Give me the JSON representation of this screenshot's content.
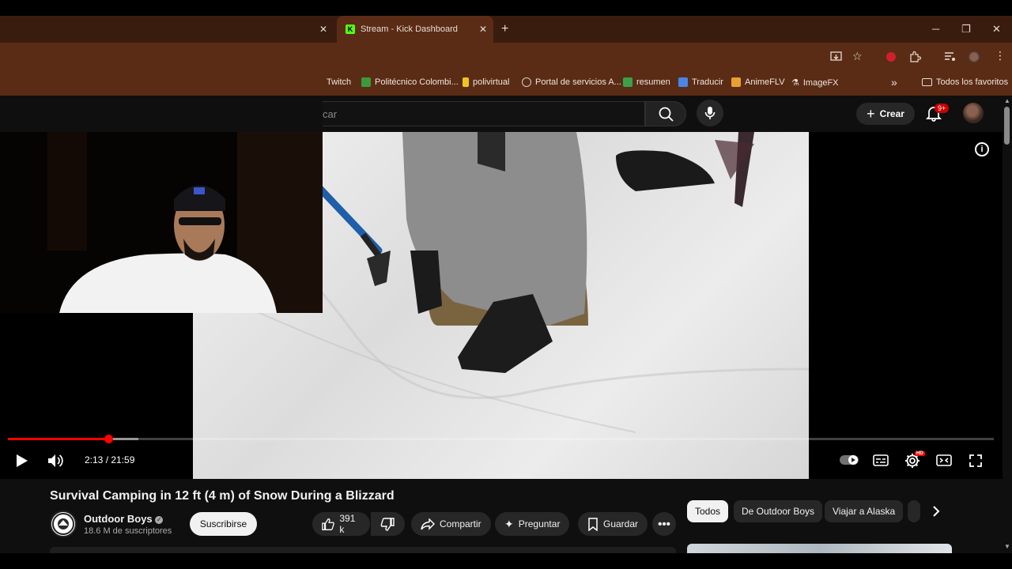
{
  "browser": {
    "tabs": [
      {
        "label": "Stream - Kick Dashboard",
        "icon": "kick-logo-icon"
      }
    ],
    "new_tab_symbol": "+",
    "bookmarks": [
      {
        "label": "Twitch"
      },
      {
        "label": "Politécnico Colombi..."
      },
      {
        "label": "polivirtual"
      },
      {
        "label": "Portal de servicios A..."
      },
      {
        "label": "resumen"
      },
      {
        "label": "Traducir"
      },
      {
        "label": "AnimeFLV"
      },
      {
        "label": "ImageFX"
      }
    ],
    "bookmarks_more": "»",
    "all_bookmarks": "Todos los favoritos"
  },
  "youtube": {
    "search_placeholder": "car",
    "create_label": "Crear",
    "notifications_badge": "9+"
  },
  "player": {
    "time_display": "2:13 / 21:59",
    "played_fraction": 0.102,
    "buffered_fraction": 0.132,
    "quality_badge": "HD",
    "info_symbol": "i"
  },
  "video": {
    "title": "Survival Camping in 12 ft (4 m) of Snow During a Blizzard",
    "channel_name": "Outdoor Boys",
    "channel_subs": "18.6 M de suscriptores",
    "subscribe_label": "Suscribirse",
    "likes_label": "391 k",
    "share_label": "Compartir",
    "ask_label": "Preguntar",
    "save_label": "Guardar"
  },
  "chips": [
    {
      "label": "Todos",
      "active": true
    },
    {
      "label": "De Outdoor Boys",
      "active": false
    },
    {
      "label": "Viajar a Alaska",
      "active": false
    }
  ],
  "colors": {
    "chrome_bg": "#3a1c0f",
    "toolbar_bg": "#5a2c16",
    "youtube_bg": "#0f0f0f",
    "progress_red": "#ff0000",
    "kick_green": "#53fc18"
  }
}
